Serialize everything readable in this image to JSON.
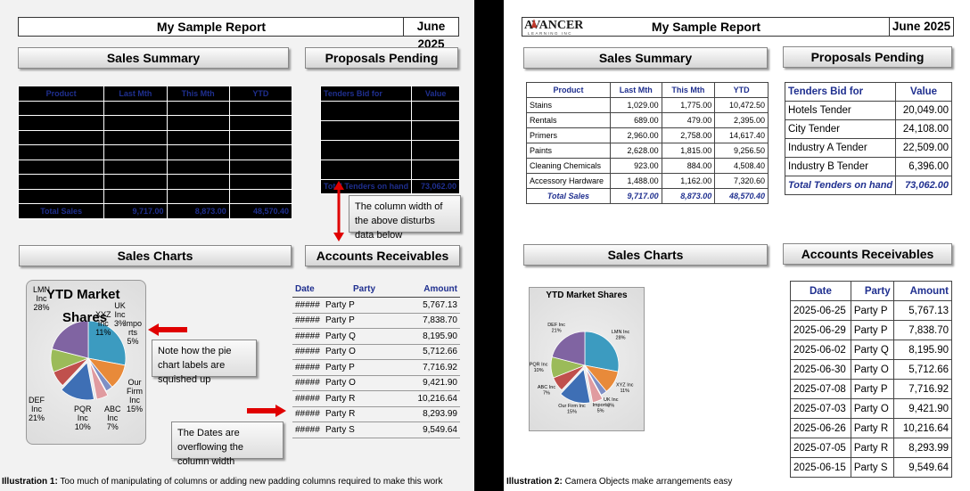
{
  "report": {
    "title": "My Sample Report",
    "month": "June 2025"
  },
  "logo": {
    "text": "AVANCER",
    "sub": "LEARNING INC"
  },
  "sections": {
    "sales_summary": "Sales Summary",
    "proposals_pending": "Proposals Pending",
    "sales_charts": "Sales Charts",
    "accounts_receivables": "Accounts Receivables"
  },
  "sales": {
    "headers": [
      "Product",
      "Last Mth",
      "This Mth",
      "YTD"
    ],
    "rows": [
      [
        "Stains",
        "1,029.00",
        "1,775.00",
        "10,472.50"
      ],
      [
        "Rentals",
        "689.00",
        "479.00",
        "2,395.00"
      ],
      [
        "Primers",
        "2,960.00",
        "2,758.00",
        "14,617.40"
      ],
      [
        "Paints",
        "2,628.00",
        "1,815.00",
        "9,256.50"
      ],
      [
        "Cleaning Chemicals",
        "923.00",
        "884.00",
        "4,508.40"
      ],
      [
        "Accessory Hardware",
        "1,488.00",
        "1,162.00",
        "7,320.60"
      ]
    ],
    "total": [
      "Total Sales",
      "9,717.00",
      "8,873.00",
      "48,570.40"
    ],
    "total_overflow": [
      "Total Sales",
      "9,717.00",
      "8,873.00",
      "48,570.40"
    ]
  },
  "tenders": {
    "headers": [
      "Tenders Bid for",
      "Value"
    ],
    "rows": [
      [
        "Hotels Tender",
        "20,049.00"
      ],
      [
        "City Tender",
        "24,108.00"
      ],
      [
        "Industry A Tender",
        "22,509.00"
      ],
      [
        "Industry B Tender",
        "6,396.00"
      ]
    ],
    "total": [
      "Total Tenders on hand",
      "73,062.00"
    ],
    "total_overflow": [
      "Total Tenders on hand",
      "73,062.00"
    ]
  },
  "receivables": {
    "headers": [
      "Date",
      "Party",
      "Amount"
    ],
    "hash": "#####",
    "rows": [
      [
        "2025-06-25",
        "Party P",
        "5,767.13"
      ],
      [
        "2025-06-29",
        "Party P",
        "7,838.70"
      ],
      [
        "2025-06-02",
        "Party Q",
        "8,195.90"
      ],
      [
        "2025-06-30",
        "Party O",
        "5,712.66"
      ],
      [
        "2025-07-08",
        "Party P",
        "7,716.92"
      ],
      [
        "2025-07-03",
        "Party O",
        "9,421.90"
      ],
      [
        "2025-06-26",
        "Party R",
        "10,216.64"
      ],
      [
        "2025-07-05",
        "Party R",
        "8,293.99"
      ],
      [
        "2025-06-15",
        "Party S",
        "9,549.64"
      ]
    ]
  },
  "chart_data": {
    "type": "pie",
    "title": "YTD Market Shares",
    "categories": [
      "LMN Inc",
      "XYZ Inc",
      "UK Inc",
      "Imports",
      "Our Firm Inc",
      "ABC Inc",
      "PQR Inc",
      "DEF Inc"
    ],
    "values": [
      28,
      11,
      3,
      5,
      15,
      7,
      10,
      21
    ],
    "labels": [
      "28%",
      "11%",
      "3%",
      "5%",
      "15%",
      "7%",
      "10%",
      "21%"
    ],
    "colors": [
      "#3c9bc0",
      "#e88a3a",
      "#7f8fc5",
      "#e09ba0",
      "#3e6fb5",
      "#c0504d",
      "#9bbb59",
      "#8064a2"
    ],
    "exploded": [
      false,
      false,
      false,
      true,
      true,
      false,
      false,
      false
    ],
    "legend": "none"
  },
  "left_squished_labels": {
    "title_a": "YTD Market",
    "title_b": "Shares",
    "lmn": "LMN\nInc\n28%",
    "xyz": "XYZ\nInc\n11%",
    "uk": "UK\nInc\n3%",
    "imports": "Impo\nrts\n5%",
    "our": "Our\nFirm\nInc\n15%",
    "abc": "ABC\nInc\n7%",
    "pqr": "PQR\nInc\n10%",
    "def": "DEF\nInc\n21%"
  },
  "notes": {
    "column_width": "The column width of the above disturbs data below",
    "pie_labels": "Note how the pie chart labels are squished up",
    "dates_overflow": "The Dates are overflowing the column width"
  },
  "captions": {
    "left_label": "Illustration 1:",
    "left_text": " Too much of manipulating of columns or adding new padding columns required to make this work",
    "right_label": "Illustration 2:",
    "right_text": " Camera Objects make arrangements easy"
  },
  "colors": {
    "header_blue": "#1f2f8f",
    "arrow_red": "#e00000"
  }
}
